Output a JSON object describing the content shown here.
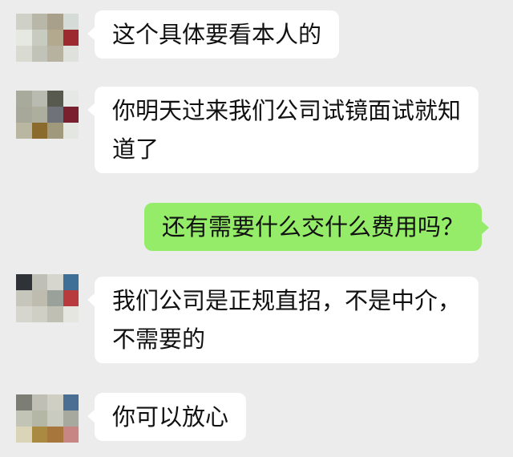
{
  "chat": {
    "messages": [
      {
        "sender": "other",
        "lines": [
          "这个具体要看本人的"
        ]
      },
      {
        "sender": "other",
        "lines": [
          "你明天过来我们公司试镜面试就知",
          "道了"
        ]
      },
      {
        "sender": "self",
        "lines": [
          "还有需要什么交什么费用吗？"
        ]
      },
      {
        "sender": "other",
        "lines": [
          "我们公司是正规直招，不是中介，",
          "不需要的"
        ]
      },
      {
        "sender": "other",
        "lines": [
          "你可以放心"
        ]
      }
    ]
  },
  "colors": {
    "background": "#ececec",
    "incoming_bubble": "#ffffff",
    "outgoing_bubble": "#95ec69",
    "text": "#111111"
  },
  "avatars": {
    "contact_1": [
      "#cfd0c8",
      "#b9b7a8",
      "#a9a08c",
      "#d5dcd8",
      "#e6e8e2",
      "#c8cbc0",
      "#b3a98e",
      "#9c2a2e",
      "#d9dad2",
      "#c2c3b8",
      "#b7b2a0",
      "#dfe2dc"
    ],
    "contact_2": [
      "#a8aa9c",
      "#b9bbb0",
      "#585a4f",
      "#e5e8e4",
      "#a7a89a",
      "#aeae9f",
      "#70727a",
      "#7a1f2e",
      "#b9b6a2",
      "#8a6a2d",
      "#a0997b",
      "#e4e6e2"
    ],
    "contact_3": [
      "#2f3338",
      "#bfbfb6",
      "#d6d6ce",
      "#3f6f96",
      "#c7c6bc",
      "#bdbcae",
      "#9aa09a",
      "#b93a3c",
      "#d6d6ce",
      "#cfcfc6",
      "#bfbfb3",
      "#e6e6e0"
    ],
    "contact_4": [
      "#7c7e76",
      "#bfbfb5",
      "#cfcfc4",
      "#4a6f93",
      "#c2c4b6",
      "#b5b7a6",
      "#c9cbc0",
      "#a7a99e",
      "#dad5b9",
      "#a98a40",
      "#a7763c",
      "#c78683"
    ]
  }
}
